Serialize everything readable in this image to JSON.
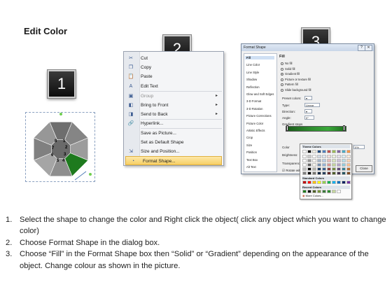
{
  "title": "Edit Color",
  "steps": [
    "1",
    "2",
    "3"
  ],
  "octagon": {
    "labels": [
      "8",
      "1",
      "7",
      "2",
      "6",
      "3",
      "5",
      "4"
    ],
    "colors": {
      "segment_gray": "#8c8c8c",
      "segment_selected": "#1e7a1e",
      "handle": "#6fcf4f"
    }
  },
  "context_menu": {
    "items": [
      {
        "label": "Cut",
        "icon": "scissors-icon",
        "glyph": "✂",
        "disabled": false,
        "submenu": false
      },
      {
        "label": "Copy",
        "icon": "copy-icon",
        "glyph": "❐",
        "disabled": false,
        "submenu": false
      },
      {
        "label": "Paste",
        "icon": "paste-icon",
        "glyph": "📋",
        "disabled": false,
        "submenu": false
      },
      {
        "label": "Edit Text",
        "icon": "edit-text-icon",
        "glyph": "A",
        "disabled": false,
        "submenu": false
      },
      {
        "label": "Group",
        "icon": "group-icon",
        "glyph": "▣",
        "disabled": true,
        "submenu": true
      },
      {
        "label": "Bring to Front",
        "icon": "bring-to-front-icon",
        "glyph": "◧",
        "disabled": false,
        "submenu": true
      },
      {
        "label": "Send to Back",
        "icon": "send-to-back-icon",
        "glyph": "◨",
        "disabled": false,
        "submenu": true
      },
      {
        "label": "Hyperlink...",
        "icon": "hyperlink-icon",
        "glyph": "🔗",
        "disabled": false,
        "submenu": false
      },
      {
        "label": "Save as Picture...",
        "icon": "",
        "glyph": "",
        "disabled": false,
        "submenu": false
      },
      {
        "label": "Set as Default Shape",
        "icon": "",
        "glyph": "",
        "disabled": false,
        "submenu": false
      },
      {
        "label": "Size and Position...",
        "icon": "size-position-icon",
        "glyph": "⇲",
        "disabled": false,
        "submenu": false
      },
      {
        "label": "Format Shape...",
        "icon": "format-shape-icon",
        "glyph": "◔",
        "disabled": false,
        "submenu": false,
        "highlighted": true
      }
    ],
    "highlight_color": "#f7cf64"
  },
  "dialog": {
    "title": "Format Shape",
    "categories": [
      "Fill",
      "Line Color",
      "Line Style",
      "Shadow",
      "Reflection",
      "Glow and Soft Edges",
      "3-D Format",
      "3-D Rotation",
      "Picture Corrections",
      "Picture Color",
      "Artistic Effects",
      "Crop",
      "Size",
      "Position",
      "Text Box",
      "Alt Text"
    ],
    "section_title": "Fill",
    "fill_options": [
      {
        "label": "No fill",
        "selected": false
      },
      {
        "label": "Solid fill",
        "selected": false
      },
      {
        "label": "Gradient fill",
        "selected": true
      },
      {
        "label": "Picture or texture fill",
        "selected": false
      },
      {
        "label": "Pattern fill",
        "selected": false
      },
      {
        "label": "Slide background fill",
        "selected": false
      }
    ],
    "preset_label": "Preset colors:",
    "type_label": "Type:",
    "type_value": "Linear",
    "direction_label": "Direction:",
    "angle_label": "Angle:",
    "angle_value": "0°",
    "stops_label": "Gradient stops",
    "color_label": "Color",
    "position_label": "Position:",
    "position_value": "0%",
    "brightness_label": "Brightness:",
    "transparency_label": "Transparency:",
    "rotate_label": "Rotate with shape",
    "close_label": "Close"
  },
  "color_picker": {
    "theme_header": "Theme Colors",
    "standard_header": "Standard Colors",
    "recent_header": "Recent Colors",
    "more_label": "More Colors...",
    "theme_top": [
      "#ffffff",
      "#000000",
      "#eeece1",
      "#1f497d",
      "#4f81bd",
      "#c0504d",
      "#9bbb59",
      "#8064a2",
      "#4bacc6",
      "#f79646"
    ],
    "standard": [
      "#c00000",
      "#ff0000",
      "#ffc000",
      "#ffff00",
      "#92d050",
      "#00b050",
      "#00b0f0",
      "#0070c0",
      "#002060",
      "#7030a0"
    ],
    "recent": [
      "#1e7a1e",
      "#000000",
      "#4f6228",
      "#76923c",
      "#3a7a3a",
      "#2e8b2e",
      "#c3d69b",
      "#ffffff"
    ]
  },
  "instructions": [
    {
      "num": "1.",
      "text": "Select the shape to change the color and Right click the object( click any object which you want to change color)"
    },
    {
      "num": "2.",
      "text": "Choose Format Shape in the dialog box."
    },
    {
      "num": "3.",
      "text": "Choose “Fill” in the Format Shape box then “Solid” or “Gradient” depending on the appearance of the object. Change colour as shown in the picture."
    }
  ]
}
